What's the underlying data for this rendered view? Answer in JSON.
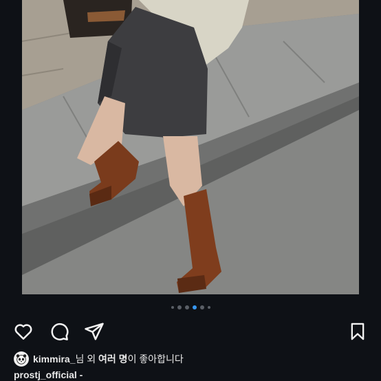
{
  "post": {
    "carousel": {
      "count": 6,
      "active_index": 2
    },
    "likes": {
      "username": "kimmira_",
      "suffix": "님 외 ",
      "count_text": "여러 명",
      "tail": "이 좋아합니다"
    },
    "caption": {
      "author": "prostj_official",
      "text": " -"
    }
  },
  "icons": {
    "like": "heart-icon",
    "comment": "comment-icon",
    "share": "send-icon",
    "save": "bookmark-icon"
  },
  "colors": {
    "background": "#0e1116",
    "active_dot": "#3897f0",
    "inactive_dot": "#5a5f66",
    "text": "#e8e8e8"
  }
}
